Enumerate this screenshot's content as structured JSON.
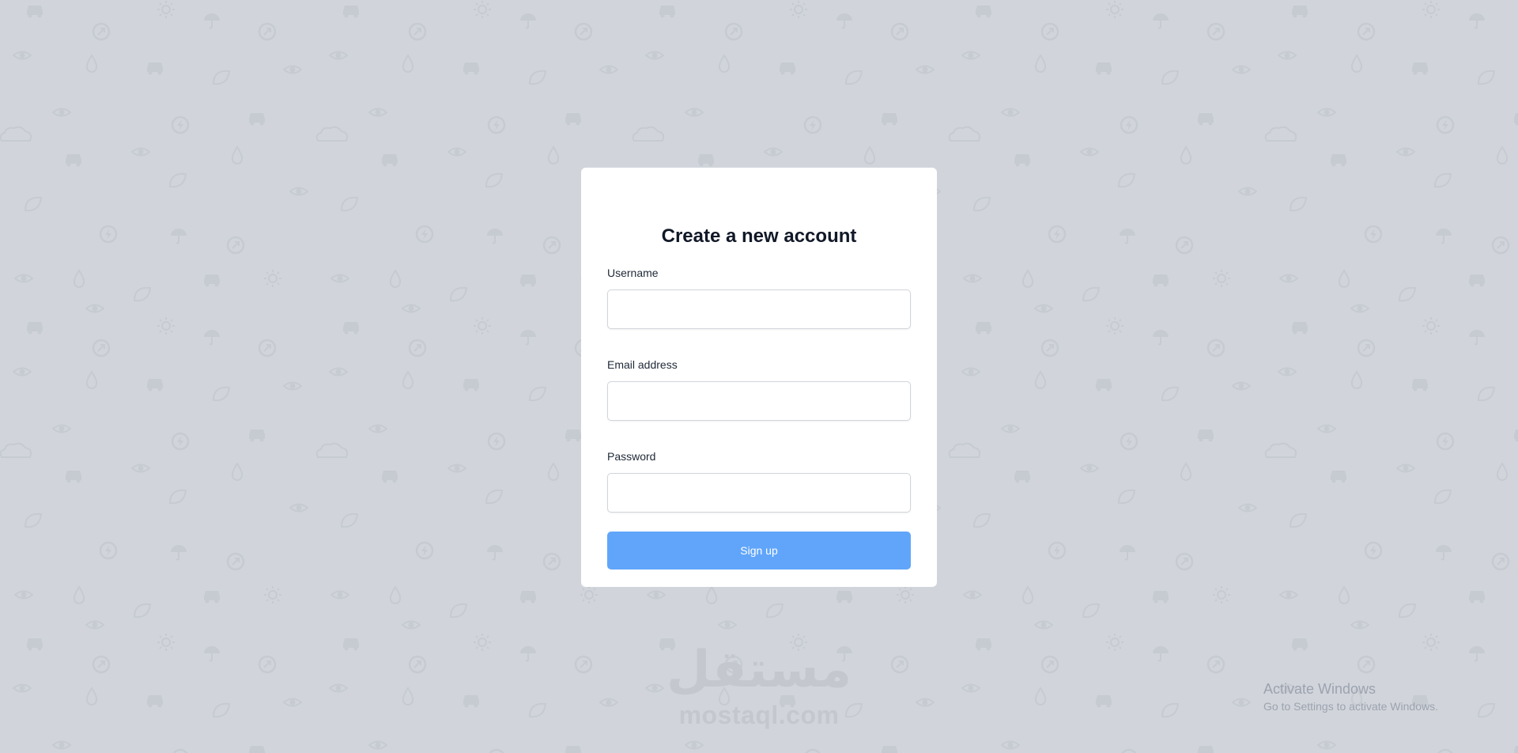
{
  "page": {
    "background_color": "#d1d5db",
    "pattern_color": "#c6cad1",
    "pattern_icons": [
      "eye-icon",
      "drop-icon",
      "car-icon",
      "leaf-icon",
      "lightning-icon",
      "cloud-icon",
      "sun-icon",
      "umbrella-icon",
      "recycle-icon"
    ]
  },
  "signup_form": {
    "title": "Create a new account",
    "fields": [
      {
        "label": "Username",
        "value": "",
        "type": "text"
      },
      {
        "label": "Email address",
        "value": "",
        "type": "email"
      },
      {
        "label": "Password",
        "value": "",
        "type": "password"
      }
    ],
    "submit_label": "Sign up",
    "accent_color": "#60a5fa"
  },
  "watermark": {
    "logo_text": "مستقل",
    "domain": "mostaql.com"
  },
  "windows_activation": {
    "title": "Activate Windows",
    "subtitle": "Go to Settings to activate Windows."
  }
}
